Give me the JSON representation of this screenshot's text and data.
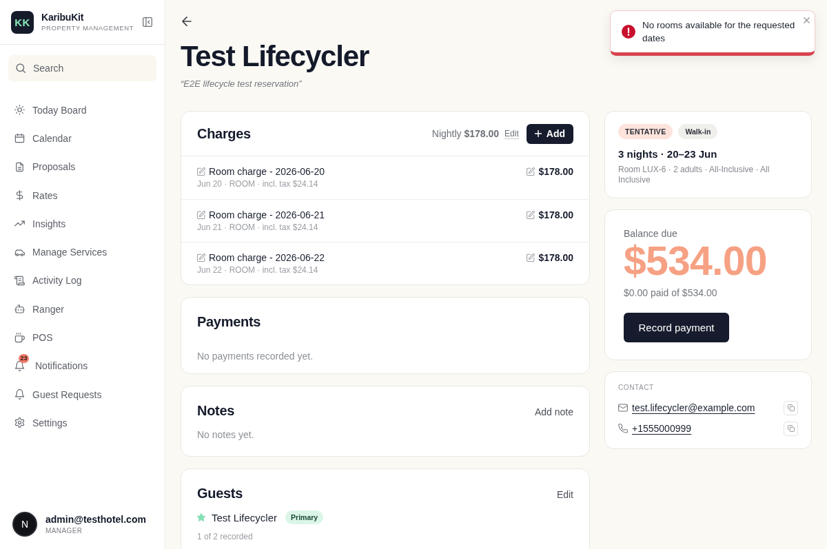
{
  "sidebar": {
    "brand": {
      "logo": "KK",
      "name": "KaribuKit",
      "tagline": "PROPERTY MANAGEMENT"
    },
    "search": {
      "placeholder": "Search"
    },
    "items": [
      {
        "label": "Today Board",
        "selected": false
      },
      {
        "label": "Calendar",
        "selected": false
      },
      {
        "label": "Proposals",
        "selected": false
      },
      {
        "label": "Rates",
        "selected": false
      },
      {
        "label": "Insights",
        "selected": false
      },
      {
        "label": "Manage Services",
        "selected": false
      },
      {
        "label": "Activity Log",
        "selected": false
      },
      {
        "label": "Ranger",
        "selected": false
      },
      {
        "label": "POS",
        "selected": false
      },
      {
        "label": "Notifications",
        "selected": false,
        "badge": "23"
      },
      {
        "label": "Guest Requests",
        "selected": false
      },
      {
        "label": "Settings",
        "selected": false
      }
    ],
    "user": {
      "avatar": "N",
      "email": "admin@testhotel.com",
      "role": "MANAGER"
    }
  },
  "header": {
    "title": "Test Lifecycler",
    "subtitle": "“E2E lifecycle test reservation”"
  },
  "toast": {
    "kind": "error",
    "message": "No rooms available for the requested dates"
  },
  "charges": {
    "title": "Charges",
    "nightly_rate": "Nightly **$178.00**",
    "edit": "Edit",
    "add": "Add",
    "rows": [
      {
        "title": "Room charge - 2026-06-20",
        "meta": "Jun 20 · ROOM · incl. tax $24.14",
        "amount": "$178.00"
      },
      {
        "title": "Room charge - 2026-06-21",
        "meta": "Jun 21 · ROOM · incl. tax $24.14",
        "amount": "$178.00"
      },
      {
        "title": "Room charge - 2026-06-22",
        "meta": "Jun 22 · ROOM · incl. tax $24.14",
        "amount": "$178.00"
      }
    ]
  },
  "payments": {
    "title": "Payments",
    "empty": "No payments recorded yet."
  },
  "notes": {
    "title": "Notes",
    "action": "Add note",
    "empty": "No notes yet."
  },
  "guests": {
    "title": "Guests",
    "action": "Edit",
    "items": [
      {
        "name": "Test Lifecycler",
        "primary": true,
        "badge": "Primary"
      }
    ],
    "count": "1 of 2 recorded"
  },
  "stay": {
    "badges": [
      {
        "label": "TENTATIVE",
        "color": "#fde3dc"
      },
      {
        "label": "Walk-in",
        "color": "#f0efeb"
      }
    ],
    "summary": "3 nights · 20–23 Jun",
    "details": "Room LUX-6 · 2 adults · All-Inclusive · All Inclusive"
  },
  "balance": {
    "label": "Balance due",
    "amount": "$534.00",
    "paid": "$0.00 paid of $534.00",
    "button": "Record payment"
  },
  "contact": {
    "heading": "CONTACT",
    "items": [
      {
        "kind": "email",
        "value": "test.lifecycler@example.com"
      },
      {
        "kind": "phone",
        "value": "+1555000999"
      }
    ]
  }
}
